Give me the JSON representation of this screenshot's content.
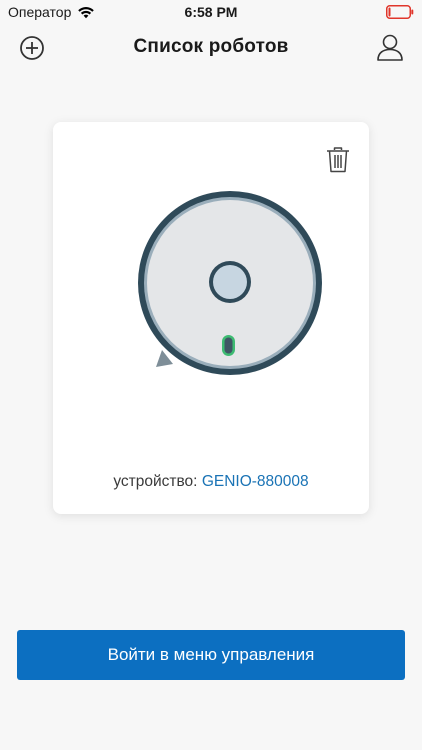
{
  "status_bar": {
    "carrier": "Оператор",
    "time": "6:58 PM",
    "wifi_icon": "wifi-icon",
    "battery_icon": "battery-icon",
    "battery_level_fraction": 0.1,
    "battery_color": "#e0362b"
  },
  "nav": {
    "title": "Список роботов",
    "add_icon": "plus-circle-icon",
    "profile_icon": "user-icon"
  },
  "robot_card": {
    "device_label": "устройство:",
    "device_name": "GENIO-880008",
    "delete_icon": "trash-icon",
    "robot_icon": "robot-vacuum-icon"
  },
  "primary_button": {
    "label": "Войти в меню управления"
  },
  "colors": {
    "accent": "#0c6fc1",
    "link": "#1a73b5",
    "background": "#f7f7f7",
    "card": "#ffffff",
    "robot_rim": "#2f4a59",
    "robot_body": "#e4e6e8",
    "indicator": "#3dbb72"
  }
}
